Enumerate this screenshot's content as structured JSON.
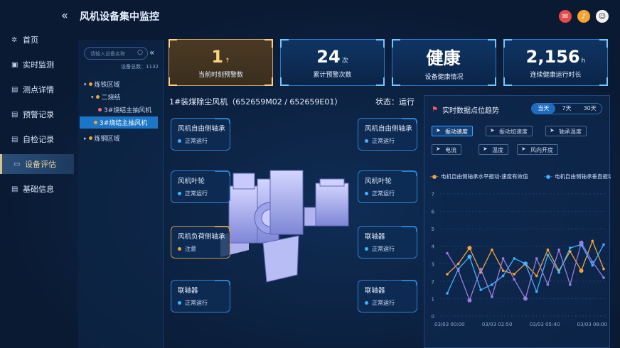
{
  "header": {
    "collapse_icon": "«",
    "title": "风机设备集中监控"
  },
  "sidebar": {
    "items": [
      {
        "label": "首页",
        "icon": "fan-icon"
      },
      {
        "label": "实时监测",
        "icon": "monitor-icon"
      },
      {
        "label": "测点详情",
        "icon": "chart-icon"
      },
      {
        "label": "预警记录",
        "icon": "alert-icon"
      },
      {
        "label": "自检记录",
        "icon": "check-icon"
      },
      {
        "label": "设备评估",
        "icon": "evaluate-icon"
      },
      {
        "label": "基础信息",
        "icon": "info-icon"
      }
    ],
    "active_index": 5
  },
  "tree": {
    "search_placeholder": "请输入设备名称",
    "count_label": "设备总数：",
    "count_value": "1132",
    "nodes": [
      {
        "label": "炼铁区域",
        "level": 0,
        "expanded": true
      },
      {
        "label": "二烧结",
        "level": 1,
        "expanded": true
      },
      {
        "label": "3#烧结主抽风机",
        "level": 2
      },
      {
        "label": "3#烧结主抽风机",
        "level": 2,
        "selected": true
      },
      {
        "label": "炼钢区域",
        "level": 0,
        "expanded": false
      }
    ]
  },
  "kpis": [
    {
      "value": "1",
      "unit": "↑",
      "label": "当前时刻预警数",
      "warn": true
    },
    {
      "value": "24",
      "unit": "次",
      "label": "累计预警次数"
    },
    {
      "value": "健康",
      "unit": "",
      "label": "设备健康情况"
    },
    {
      "value": "2,156",
      "unit": "h",
      "label": "连续健康运行时长"
    }
  ],
  "device": {
    "title": "1#装煤除尘风机（652659M02 / 652659E01）",
    "status_label": "状态：",
    "status_value": "运行",
    "points": [
      {
        "name": "风机自由侧轴承",
        "status": "正常运行",
        "side": "left",
        "row": 0
      },
      {
        "name": "风机叶轮",
        "status": "正常运行",
        "side": "left",
        "row": 1
      },
      {
        "name": "风机负荷侧轴承",
        "status": "注意",
        "side": "left",
        "row": 2,
        "warn": true
      },
      {
        "name": "联轴器",
        "status": "正常运行",
        "side": "left",
        "row": 3
      },
      {
        "name": "风机自由侧轴承",
        "status": "正常运行",
        "side": "right",
        "row": 0
      },
      {
        "name": "风机叶轮",
        "status": "正常运行",
        "side": "right",
        "row": 1
      },
      {
        "name": "联轴器",
        "status": "正常运行",
        "side": "right",
        "row": 2
      },
      {
        "name": "联轴器",
        "status": "正常运行",
        "side": "right",
        "row": 3
      }
    ]
  },
  "trend": {
    "title": "实时数据点位趋势",
    "ranges": [
      "当天",
      "7天",
      "30天"
    ],
    "active_range": 0,
    "chips": [
      {
        "label": "振动速度",
        "on": true
      },
      {
        "label": "振动加速度",
        "on": false
      },
      {
        "label": "轴承温度",
        "on": false
      },
      {
        "label": "电流",
        "on": false
      },
      {
        "label": "温度",
        "on": false
      },
      {
        "label": "风向开度",
        "on": false
      }
    ]
  },
  "colors": {
    "accent": "#1d6ec2",
    "warn": "#f0a43a",
    "ok": "#3fb3ff",
    "alert": "#ff5e5e"
  },
  "chart_data": {
    "type": "line",
    "yticks": [
      "0",
      "1",
      "2",
      "3",
      "4",
      "5",
      "6",
      "7"
    ],
    "xticks": [
      "03/03 00:00",
      "03/03 02:50",
      "03/03 05:40",
      "03/03 08:00"
    ],
    "ylim": [
      0,
      7
    ],
    "series": [
      {
        "name": "电机自由侧轴承水平振动-速度有效值",
        "color": "#f0a43a",
        "values": [
          2.4,
          3.0,
          3.9,
          2.5,
          3.8,
          2.6,
          2.4,
          3.0,
          2.3,
          3.8,
          2.6,
          3.7,
          2.6,
          4.3,
          2.7
        ]
      },
      {
        "name": "电机自由侧轴承垂直振动-速度有效值",
        "color": "#3fb3ff",
        "values": [
          1.3,
          2.7,
          3.4,
          1.5,
          1.8,
          2.3,
          3.3,
          3.0,
          1.4,
          3.5,
          2.5,
          3.9,
          4.1,
          2.9,
          4.1
        ]
      },
      {
        "name": "",
        "color": "#9a7be0",
        "values": [
          3.6,
          2.6,
          0.9,
          2.7,
          1.1,
          3.3,
          2.1,
          1.0,
          3.3,
          1.8,
          3.8,
          1.8,
          4.2,
          3.1,
          2.2
        ]
      }
    ]
  }
}
